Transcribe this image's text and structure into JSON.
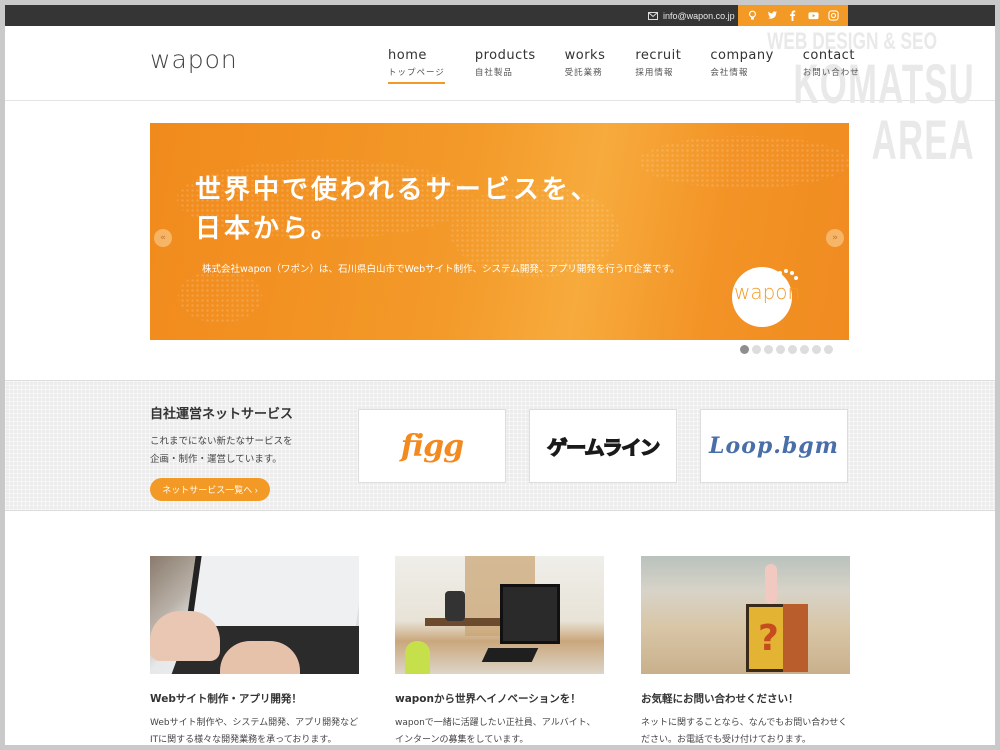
{
  "topbar": {
    "email": "info@wapon.co.jp",
    "social": [
      {
        "name": "lightbulb-icon"
      },
      {
        "name": "twitter-icon"
      },
      {
        "name": "facebook-icon"
      },
      {
        "name": "youtube-icon"
      },
      {
        "name": "instagram-icon"
      }
    ],
    "accent": "#f39a26"
  },
  "header": {
    "logo": "wapon",
    "watermark_line1": "WEB DESIGN & SEO",
    "watermark_line2": "KOMATSU AREA",
    "nav": [
      {
        "en": "home",
        "ja": "トップページ",
        "active": true
      },
      {
        "en": "products",
        "ja": "自社製品"
      },
      {
        "en": "works",
        "ja": "受託業務"
      },
      {
        "en": "recruit",
        "ja": "採用情報"
      },
      {
        "en": "company",
        "ja": "会社情報"
      },
      {
        "en": "contact",
        "ja": "お問い合わせ"
      }
    ]
  },
  "hero": {
    "title_line1": "世界中で使われるサービスを、",
    "title_line2": "日本から。",
    "subtitle": "株式会社wapon（ワポン）は、石川県白山市でWebサイト制作、システム開発、アプリ開発を行うIT企業です。",
    "logo": "wapon",
    "prev_label": "«",
    "next_label": "»",
    "slide_count": 8,
    "active_slide": 1
  },
  "services": {
    "title": "自社運営ネットサービス",
    "desc_line1": "これまでにない新たなサービスを",
    "desc_line2": "企画・制作・運営しています。",
    "button": "ネットサービス一覧へ ›",
    "cards": [
      {
        "label": "figg"
      },
      {
        "label": "ゲームライン"
      },
      {
        "label": "Loop.bgm"
      }
    ]
  },
  "features": [
    {
      "title": "Webサイト制作・アプリ開発！",
      "desc_line1": "Webサイト制作や、システム開発、アプリ開発など",
      "desc_line2": "ITに関する様々な開発業務を承っております。"
    },
    {
      "title": "waponから世界へイノベーションを！",
      "desc_line1": "waponで一緒に活躍したい正社員、アルバイト、",
      "desc_line2": "インターンの募集をしています。"
    },
    {
      "title": "お気軽にお問い合わせください！",
      "desc_line1": "ネットに関することなら、なんでもお問い合わせく",
      "desc_line2": "ださい。お電話でも受け付けております。"
    }
  ]
}
